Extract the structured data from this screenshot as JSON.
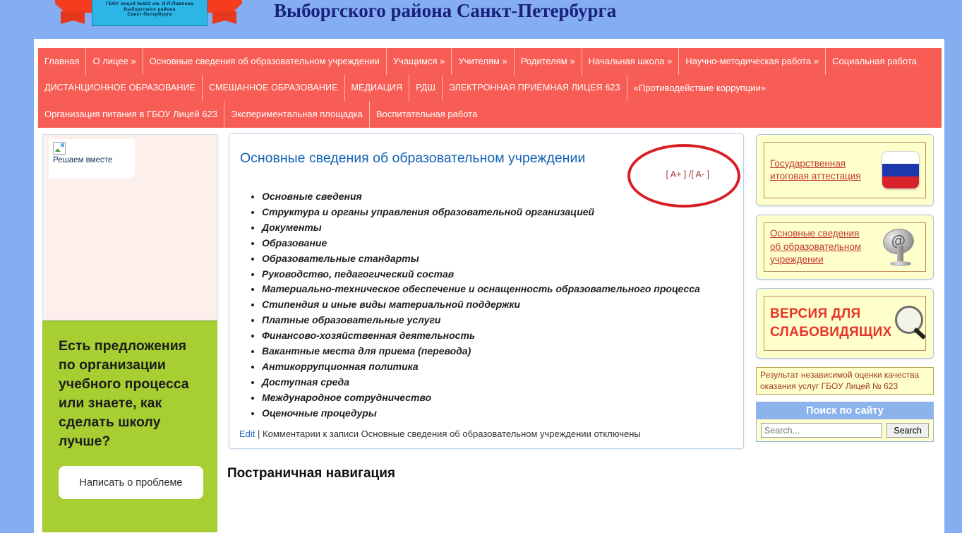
{
  "header": {
    "logo_lines": [
      "ГБОУ лицей №623 им. И.П.Павлова",
      "Выборгского района",
      "Санкт-Петербурга"
    ],
    "site_title": "Выборгского района Санкт-Петербурга"
  },
  "nav": {
    "row1": [
      "Главная",
      "О лицее »",
      "Основные сведения об образовательном учреждении",
      "Учащимся »",
      "Учителям »",
      "Родителям »",
      "Начальная школа »",
      "Научно-методическая работа »",
      "Социальная работа"
    ],
    "row2": [
      "ДИСТАНЦИОННОЕ ОБРАЗОВАНИЕ",
      "СМЕШАННОЕ ОБРАЗОВАНИЕ",
      "МЕДИАЦИЯ",
      "РДШ",
      "ЭЛЕКТРОННАЯ ПРИЁМНАЯ ЛИЦЕЯ 623",
      "«Противодействие коррупции»"
    ],
    "row3": [
      "Организация питания в ГБОУ Лицей 623",
      "Экспериментальная площадка",
      "Воспитательная работа"
    ]
  },
  "sidebar_left": {
    "broken_image_alt": "Решаем вместе",
    "promo_text": "Есть предложения по организации учебного процесса или знаете, как сделать школу лучше?",
    "promo_button": "Написать о проблеме"
  },
  "main": {
    "title": "Основные сведения об образовательном учреждении",
    "font_size_control": "[ A+ ] /[ A- ]",
    "bullets": [
      "Основные сведения",
      "Структура и органы управления образовательной организацией",
      "Документы",
      "Образование",
      "Образовательные стандарты",
      "Руководство, педагогический состав",
      "Материально-техническое обеспечение и оснащенность образовательного процесса",
      "Стипендия и иные виды материальной поддержки",
      "Платные образовательные услуги",
      "Финансово-хозяйственная деятельность",
      "Вакантные места для приема (перевода)",
      "Антикоррупционная политика",
      "Доступная среда",
      "Международное сотрудничество",
      "Оценочные процедуры"
    ],
    "edit_link": "Edit",
    "comments_note": "| Комментарии к записи Основные сведения об образовательном учреждении отключены",
    "section_heading": "Постраничная навигация"
  },
  "sidebar_right": {
    "banner_gia": [
      "Государственная",
      "итоговая аттестация"
    ],
    "banner_osnov": [
      "Основные сведения",
      "об образовательном",
      "учреждении"
    ],
    "banner_vision": [
      "ВЕРСИЯ ДЛЯ",
      "СЛАБОВИДЯЩИХ"
    ],
    "nok_text": "Результат независимой оценки качества оказания услуг ГБОУ Лицей № 623",
    "search": {
      "title": "Поиск по сайту",
      "placeholder": "Search...",
      "value": "",
      "button": "Search"
    },
    "at_symbol": "@"
  },
  "colors": {
    "page_background": "#85aef2",
    "nav_background": "#f75d54",
    "title_blue": "#19207a",
    "content_title_blue": "#1463b5",
    "promo_green": "#a8cf32",
    "banner_yellow": "#ffffcc",
    "annotation_red": "#d81f26"
  }
}
